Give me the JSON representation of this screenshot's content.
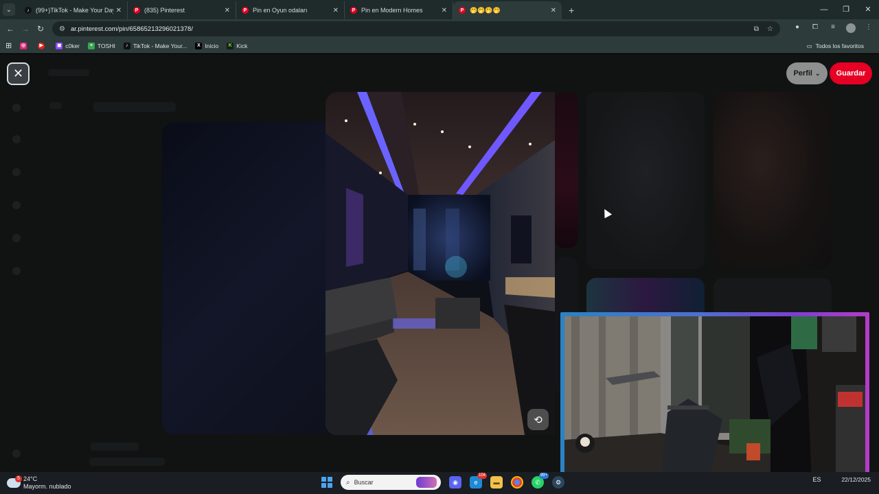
{
  "browser": {
    "tabs": [
      {
        "title": "(99+)TikTok - Make Your Day",
        "favicon": "tiktok-icon",
        "active": false
      },
      {
        "title": "(835) Pinterest",
        "favicon": "pinterest-icon",
        "active": false
      },
      {
        "title": "Pin en Oyun odaları",
        "favicon": "pinterest-icon",
        "active": false
      },
      {
        "title": "Pin en Modern Homes",
        "favicon": "pinterest-icon",
        "active": false
      },
      {
        "title": "🤭🤭🤭🤭",
        "favicon": "pinterest-icon",
        "active": true
      }
    ],
    "new_tab": "+",
    "url": "ar.pinterest.com/pin/658652132960213​78/",
    "bookmarks": [
      {
        "label": "",
        "icon": "instagram-icon",
        "color": "#d62976"
      },
      {
        "label": "",
        "icon": "youtube-icon",
        "color": "#e62117"
      },
      {
        "label": "c0ker",
        "icon": "twitch-icon",
        "color": "#9146ff"
      },
      {
        "label": "TOSHI",
        "icon": "toshi-icon",
        "color": "#35a852"
      },
      {
        "label": "TikTok - Make Your...",
        "icon": "tiktok-icon",
        "color": "#111111"
      },
      {
        "label": "Inicio",
        "icon": "x-icon",
        "color": "#000000"
      },
      {
        "label": "Kick",
        "icon": "kick-icon",
        "color": "#53fc18"
      }
    ],
    "all_bookmarks": "Todos los favoritos"
  },
  "pin": {
    "profile_label": "Perfil",
    "save_label": "Guardar"
  },
  "taskbar": {
    "weather": {
      "temp": "24°C",
      "desc": "Mayorm. nublado",
      "badge": "5"
    },
    "search_placeholder": "Buscar",
    "badges": {
      "edge": "104",
      "whatsapp": "99+"
    },
    "lang": "ES",
    "date": "22/12/2025"
  },
  "colors": {
    "accent_red": "#e60023",
    "chrome_bg": "#2d3b3b"
  }
}
